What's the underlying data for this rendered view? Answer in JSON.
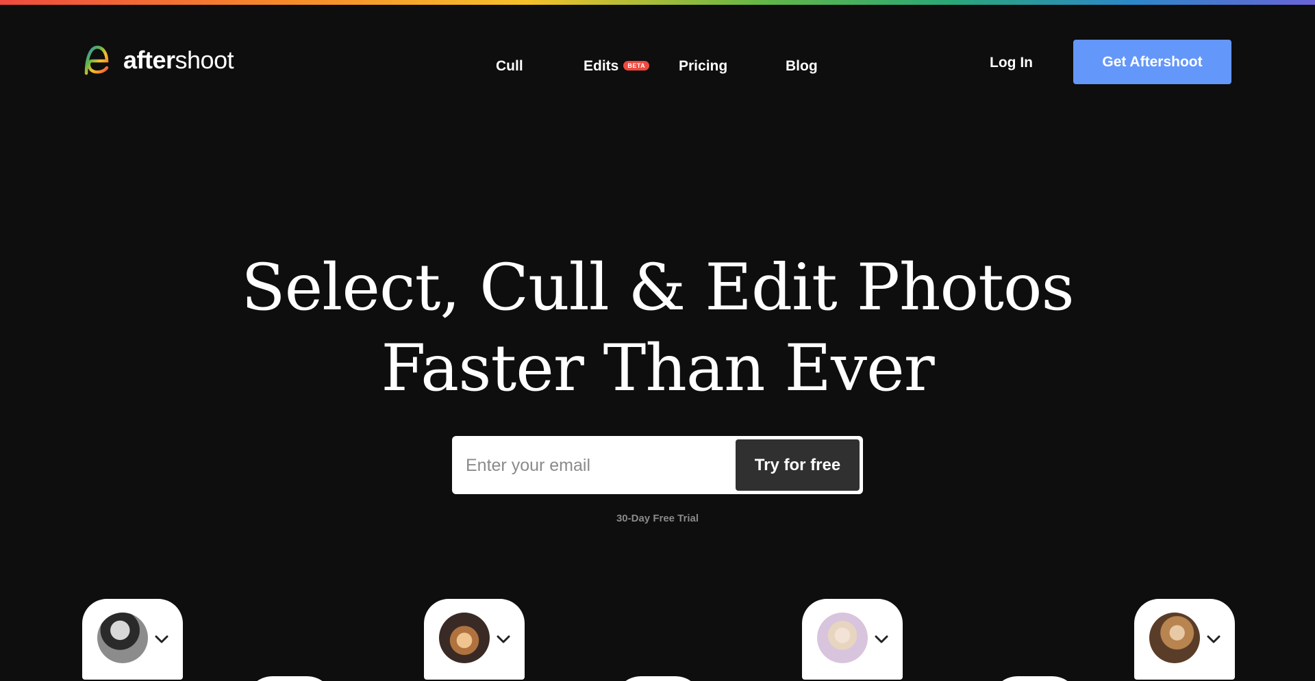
{
  "brand": {
    "name_bold": "after",
    "name_light": "shoot",
    "logo_icon": "aftershoot-logo-icon"
  },
  "nav": {
    "items": [
      {
        "label": "Cull"
      },
      {
        "label": "Edits",
        "badge": "BETA"
      },
      {
        "label": "Pricing"
      },
      {
        "label": "Blog"
      }
    ]
  },
  "header": {
    "login_label": "Log In",
    "cta_label": "Get Aftershoot"
  },
  "hero": {
    "title_line1": "Select, Cull & Edit Photos",
    "title_line2": "Faster Than Ever",
    "email_placeholder": "Enter your email",
    "submit_label": "Try for free",
    "trial_note": "30-Day Free Trial"
  },
  "profiles": [
    {
      "icon": "photographer-avatar-1",
      "chevron": "chevron-down-icon"
    },
    {
      "icon": "photographer-avatar-2",
      "chevron": "chevron-down-icon"
    },
    {
      "icon": "photographer-avatar-3",
      "chevron": "chevron-down-icon"
    },
    {
      "icon": "photographer-avatar-4",
      "chevron": "chevron-down-icon"
    }
  ],
  "colors": {
    "background": "#0e0e0e",
    "cta": "#6497fa",
    "beta_badge": "#ef4a3f",
    "submit_button": "#303030"
  }
}
